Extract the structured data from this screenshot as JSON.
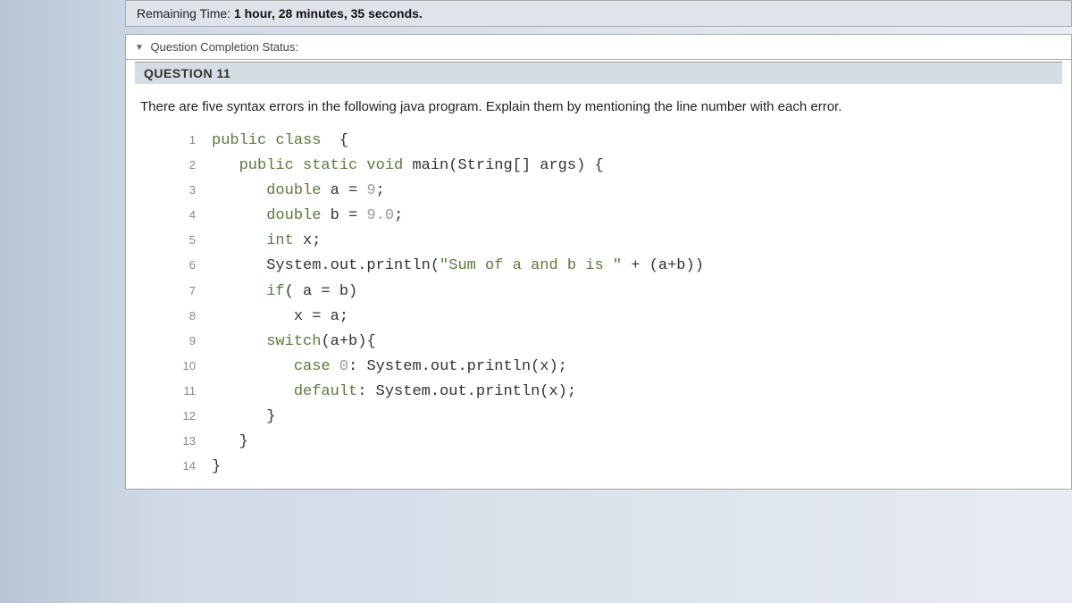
{
  "timer": {
    "label": "Remaining Time:",
    "value": "1 hour, 28 minutes, 35 seconds."
  },
  "status": {
    "label": "Question Completion Status:"
  },
  "question": {
    "header": "QUESTION 11",
    "prompt": "There are five syntax errors in the following java program. Explain them by mentioning the line number with each error."
  },
  "code": {
    "lines": [
      {
        "n": "1",
        "html": "<span class='kw'>public</span> <span class='kw'>class</span>  {"
      },
      {
        "n": "2",
        "html": "   <span class='kw'>public static void</span> main(String[] args) {"
      },
      {
        "n": "3",
        "html": "      <span class='kw'>double</span> a = <span class='dim'>9</span>;"
      },
      {
        "n": "4",
        "html": "      <span class='kw'>double</span> b = <span class='dim'>9.0</span>;"
      },
      {
        "n": "5",
        "html": "      <span class='kw'>int</span> x;"
      },
      {
        "n": "6",
        "html": "      System.out.println(<span class='str'>\"Sum of a and b is \"</span> + (a+b))"
      },
      {
        "n": "7",
        "html": "      <span class='kw'>if</span>( a = b)"
      },
      {
        "n": "8",
        "html": "         x = a;"
      },
      {
        "n": "9",
        "html": "      <span class='kw'>switch</span>(a+b){"
      },
      {
        "n": "10",
        "html": "         <span class='kw'>case</span> <span class='dim'>0</span>: System.out.println(x);"
      },
      {
        "n": "11",
        "html": "         <span class='kw'>default</span>: System.out.println(x);"
      },
      {
        "n": "12",
        "html": "      }"
      },
      {
        "n": "13",
        "html": "   }"
      },
      {
        "n": "14",
        "html": "}"
      }
    ]
  }
}
